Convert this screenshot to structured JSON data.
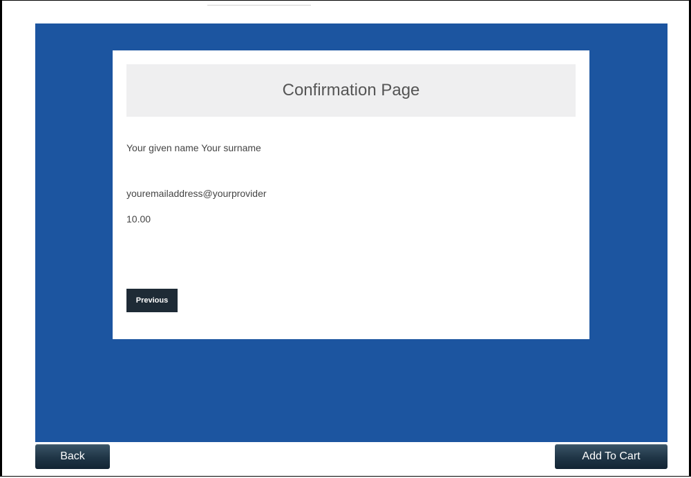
{
  "confirmation": {
    "title": "Confirmation Page",
    "full_name": "Your given name Your surname",
    "email": "youremailaddress@yourprovider",
    "amount": "10.00",
    "previous_label": "Previous"
  },
  "footer": {
    "back_label": "Back",
    "add_to_cart_label": "Add To Cart"
  },
  "colors": {
    "panel_blue": "#1c55a0",
    "header_gray": "#efeff0",
    "button_dark": "#1e2b36"
  }
}
